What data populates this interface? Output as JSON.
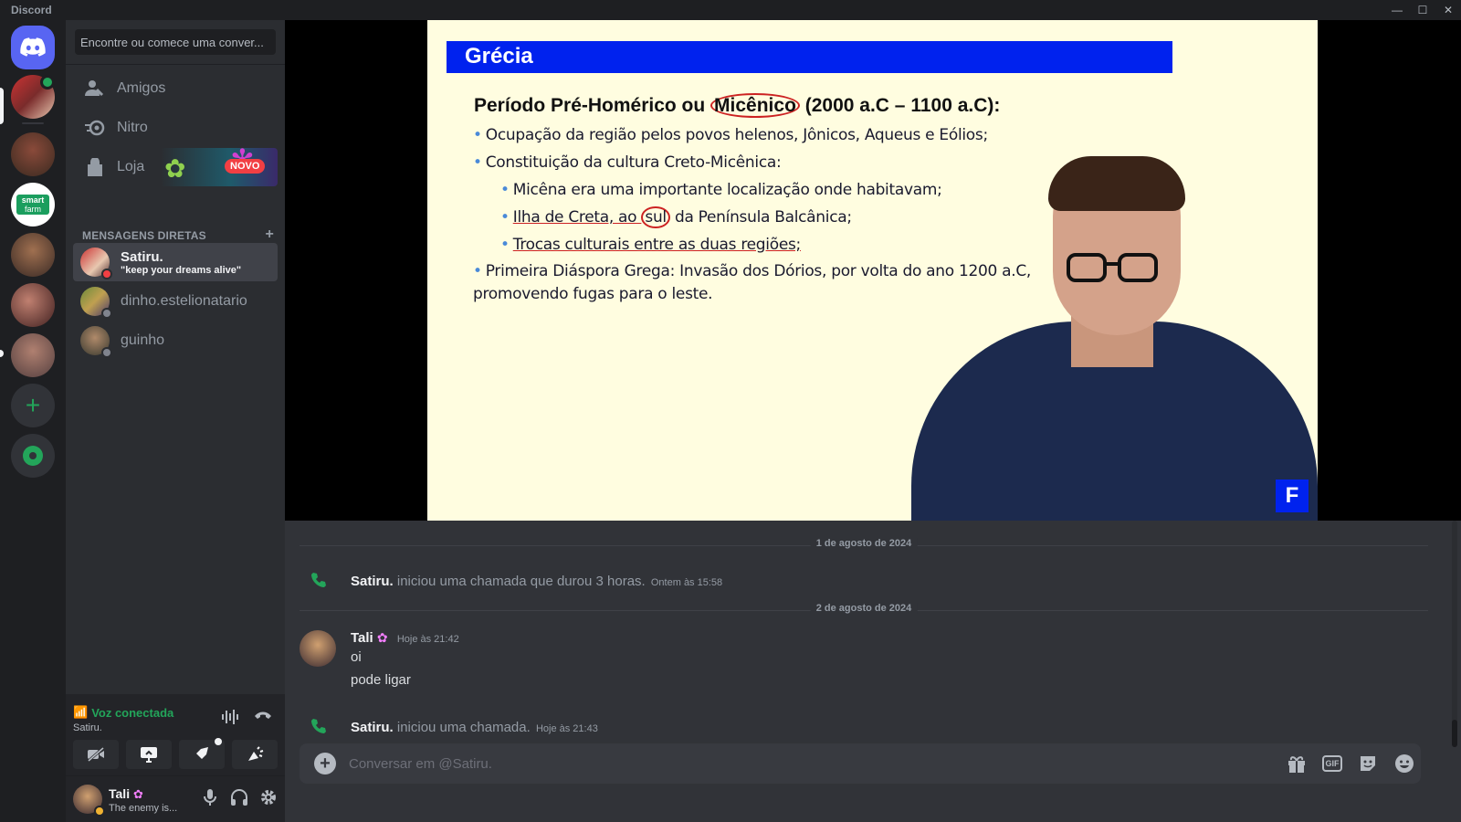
{
  "app": {
    "title": "Discord"
  },
  "dm_column": {
    "search_placeholder": "Encontre ou comece uma conver...",
    "nav": [
      {
        "label": "Amigos",
        "icon": "friends-icon"
      },
      {
        "label": "Nitro",
        "icon": "nitro-icon"
      },
      {
        "label": "Loja",
        "icon": "shop-icon",
        "badge": "NOVO"
      }
    ],
    "dm_header": "MENSAGENS DIRETAS",
    "dms": [
      {
        "name": "Satiru.",
        "status_text": "\"keep your dreams alive\"",
        "status": "dnd"
      },
      {
        "name": "dinho.estelionatario",
        "status": "offline"
      },
      {
        "name": "guinho",
        "status": "offline"
      }
    ]
  },
  "voice": {
    "status": "Voz conectada",
    "channel": "Satiru."
  },
  "user": {
    "name": "Tali",
    "status": "The enemy is..."
  },
  "slide": {
    "title": "Grécia",
    "heading": "Período Pré-Homérico ou Micênico (2000 a.C – 1100 a.C):",
    "heading_pre": "Período Pré-Homérico ou ",
    "heading_circ": "Micênico",
    "heading_post": " (2000 a.C – 1100 a.C):",
    "b1": "Ocupação da região pelos povos helenos, Jônicos, Aqueus e Eólios;",
    "b2": "Constituição da cultura Creto-Micênica:",
    "b2a": "Micêna era uma importante localização onde habitavam;",
    "b2b_pre": "Ilha de Creta, ao ",
    "b2b_circ": "sul",
    "b2b_post": " da Península Balcânica;",
    "b2c": "Trocas culturais entre as duas regiões;",
    "b3_line1": "Primeira Diáspora Grega: Invasão dos Dórios, por volta do ano 1200 a.C,",
    "b3_line2": "promovendo fugas para o leste.",
    "logo": "F"
  },
  "chat": {
    "date1": "1 de agosto de 2024",
    "call1": {
      "user": "Satiru.",
      "text": "iniciou uma chamada que durou 3 horas.",
      "time": "Ontem às 15:58"
    },
    "date2": "2 de agosto de 2024",
    "message": {
      "author": "Tali",
      "time": "Hoje às 21:42",
      "lines": [
        "oi",
        "pode ligar"
      ]
    },
    "call2": {
      "user": "Satiru.",
      "text": "iniciou uma chamada.",
      "time": "Hoje às 21:43"
    }
  },
  "composer": {
    "placeholder": "Conversar em @Satiru.",
    "gif_label": "GIF"
  },
  "colors": {
    "brand": "#5865f2",
    "online": "#23a55a",
    "dnd": "#f23f43",
    "slide_blue": "#0022ee",
    "slide_bg": "#fffde0"
  }
}
